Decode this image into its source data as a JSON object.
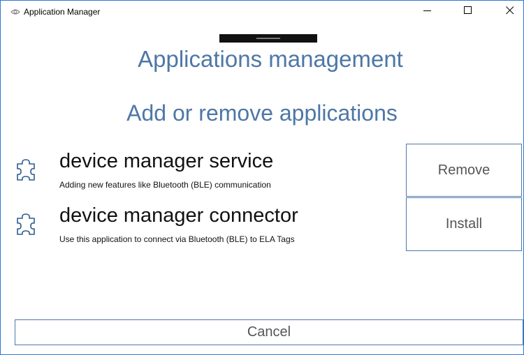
{
  "window": {
    "title": "Application Manager",
    "app_icon": "eye-logo-icon",
    "controls": {
      "minimize_icon": "minimize-icon",
      "maximize_icon": "maximize-icon",
      "close_icon": "close-icon"
    }
  },
  "main": {
    "title": "Applications management",
    "subtitle": "Add or remove applications",
    "applications": [
      {
        "icon": "puzzle-icon",
        "name": "device manager service",
        "description": "Adding new features like Bluetooth (BLE) communication"
      },
      {
        "icon": "puzzle-icon",
        "name": "device manager connector",
        "description": "Use this application to connect via Bluetooth (BLE) to ELA Tags"
      }
    ],
    "actions": {
      "remove_label": "Remove",
      "install_label": "Install"
    },
    "cancel_label": "Cancel"
  },
  "colors": {
    "accent": "#4e77a6",
    "window_border": "#2b79d4",
    "button_text": "#555555"
  }
}
